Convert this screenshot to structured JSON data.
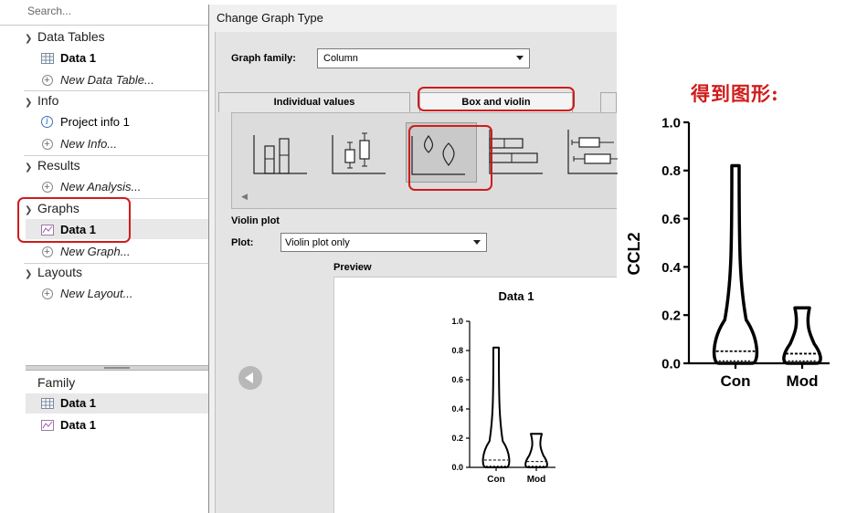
{
  "navigator": {
    "search_placeholder": "Search...",
    "sections": [
      {
        "name": "Data Tables",
        "items": [
          {
            "label": "Data 1",
            "kind": "table"
          },
          {
            "label": "New Data Table...",
            "kind": "new"
          }
        ]
      },
      {
        "name": "Info",
        "items": [
          {
            "label": "Project info 1",
            "kind": "info"
          },
          {
            "label": "New Info...",
            "kind": "new"
          }
        ]
      },
      {
        "name": "Results",
        "items": [
          {
            "label": "New Analysis...",
            "kind": "new"
          }
        ]
      },
      {
        "name": "Graphs",
        "items": [
          {
            "label": "Data 1",
            "kind": "graph"
          },
          {
            "label": "New Graph...",
            "kind": "new"
          }
        ]
      },
      {
        "name": "Layouts",
        "items": [
          {
            "label": "New Layout...",
            "kind": "new"
          }
        ]
      }
    ],
    "family": {
      "title": "Family",
      "items": [
        {
          "label": "Data 1",
          "kind": "table"
        },
        {
          "label": "Data 1",
          "kind": "graph"
        }
      ]
    }
  },
  "dialog": {
    "title": "Change Graph Type",
    "graph_family_label": "Graph family:",
    "graph_family_value": "Column",
    "tabs": [
      "Individual values",
      "Box and violin"
    ],
    "active_tab": "Box and violin",
    "thumbnails": [
      "column-bars-icon",
      "box-whisker-icon",
      "violin-icon",
      "horizontal-bars-icon",
      "horizontal-box-icon"
    ],
    "selected_thumbnail": "violin-icon",
    "violin_plot_label": "Violin plot",
    "plot_label": "Plot:",
    "plot_value": "Violin plot only",
    "preview_label": "Preview"
  },
  "caption": "得到图形:",
  "colors": {
    "highlight": "#d01c1c",
    "selection": "#e8e8e8",
    "dialog_bg": "#f0f0f0"
  },
  "chart_data": [
    {
      "type": "violin",
      "title": "Data 1",
      "categories": [
        "Con",
        "Mod"
      ],
      "ylim": [
        0,
        1.0
      ],
      "yticks": [
        "0.0",
        "0.2",
        "0.4",
        "0.6",
        "0.8",
        "1.0"
      ],
      "series": [
        {
          "category": "Con",
          "min": 0.0,
          "max": 0.82,
          "median": 0.05,
          "quartile_lower": 0.01
        },
        {
          "category": "Mod",
          "min": 0.0,
          "max": 0.23,
          "median": 0.04,
          "quartile_lower": 0.01
        }
      ]
    },
    {
      "type": "violin",
      "ylabel": "CCL2",
      "categories": [
        "Con",
        "Mod"
      ],
      "ylim": [
        0,
        1.0
      ],
      "yticks": [
        "0.0",
        "0.2",
        "0.4",
        "0.6",
        "0.8",
        "1.0"
      ],
      "series": [
        {
          "category": "Con",
          "min": 0.0,
          "max": 0.82,
          "median": 0.05,
          "quartile_lower": 0.01
        },
        {
          "category": "Mod",
          "min": 0.0,
          "max": 0.23,
          "median": 0.04,
          "quartile_lower": 0.01
        }
      ]
    }
  ]
}
